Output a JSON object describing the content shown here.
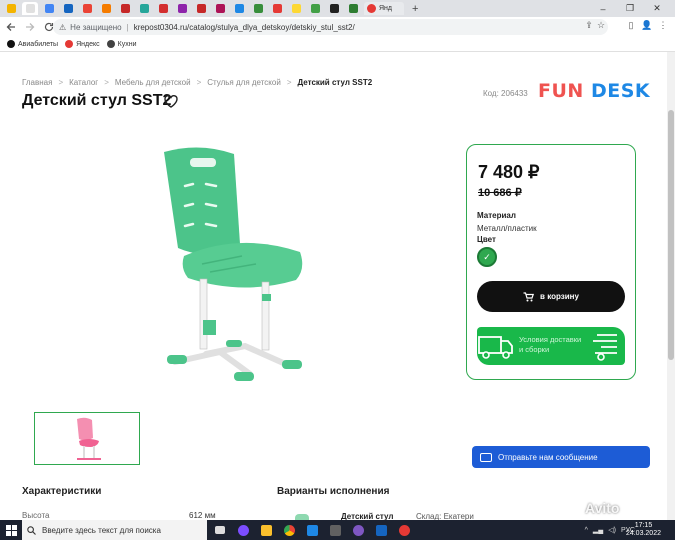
{
  "browser": {
    "tabs": [
      {
        "color": "#f4b400"
      },
      {
        "color": "#e0e0e0",
        "active": true
      },
      {
        "color": "#4285f4"
      },
      {
        "color": "#1565c0"
      },
      {
        "color": "#ea4335"
      },
      {
        "color": "#f57c00"
      },
      {
        "color": "#c62828"
      },
      {
        "color": "#26a69a"
      },
      {
        "color": "#d32f2f"
      },
      {
        "color": "#8e24aa"
      },
      {
        "color": "#c62828"
      },
      {
        "color": "#ad1457"
      },
      {
        "color": "#1e88e5"
      },
      {
        "color": "#388e3c"
      },
      {
        "color": "#e53935"
      },
      {
        "color": "#fdd835"
      },
      {
        "color": "#43a047"
      },
      {
        "color": "#212121"
      },
      {
        "color": "#2e7d32"
      }
    ],
    "last_tab": {
      "label": "Янд",
      "color": "#e53935"
    },
    "new_tab": "+",
    "window_controls": [
      "–",
      "❐",
      "✕"
    ],
    "omnibox": {
      "security_icon": "warning-icon",
      "security_text": "Не защищено",
      "url": "krepost0304.ru/catalog/stulya_dlya_detskoy/detskiy_stul_sst2/"
    },
    "bookmarks": [
      {
        "label": "Авиабилеты",
        "color": "#111111"
      },
      {
        "label": "Яндекс",
        "color": "#e53935"
      },
      {
        "label": "Кухни",
        "color": "#424242"
      }
    ]
  },
  "page": {
    "breadcrumb": [
      "Главная",
      "Каталог",
      "Мебель для детской",
      "Стулья для детской",
      "Детский стул SST2"
    ],
    "breadcrumb_sep": ">",
    "title": "Детский стул SST2",
    "code": "Код: 206433",
    "logo": {
      "part1": "FUN",
      "part2": "DESK"
    },
    "price": "7 480 ₽",
    "old_price": "10 686 ₽",
    "material_label": "Материал",
    "material_value": "Металл/пластик",
    "color_label": "Цвет",
    "color_check": "✓",
    "selected_color": "#2fa84f",
    "cart_button": "в корзину",
    "delivery_text_1": "Условия доставки",
    "delivery_text_2": "и сборки",
    "specs_heading": "Характеристики",
    "variants_heading": "Варианты исполнения",
    "spec_rows": [
      {
        "name": "Высота",
        "value": "612 мм"
      }
    ],
    "variant": {
      "name": "Детский стул",
      "stock": "Склад: Екатери"
    },
    "chat_button": "Отправьте нам сообщение"
  },
  "taskbar": {
    "search_placeholder": "Введите здесь текст для поиска",
    "tray_lang": "РУС",
    "time": "17:15",
    "date": "24.03.2022"
  },
  "watermark": "Avito"
}
